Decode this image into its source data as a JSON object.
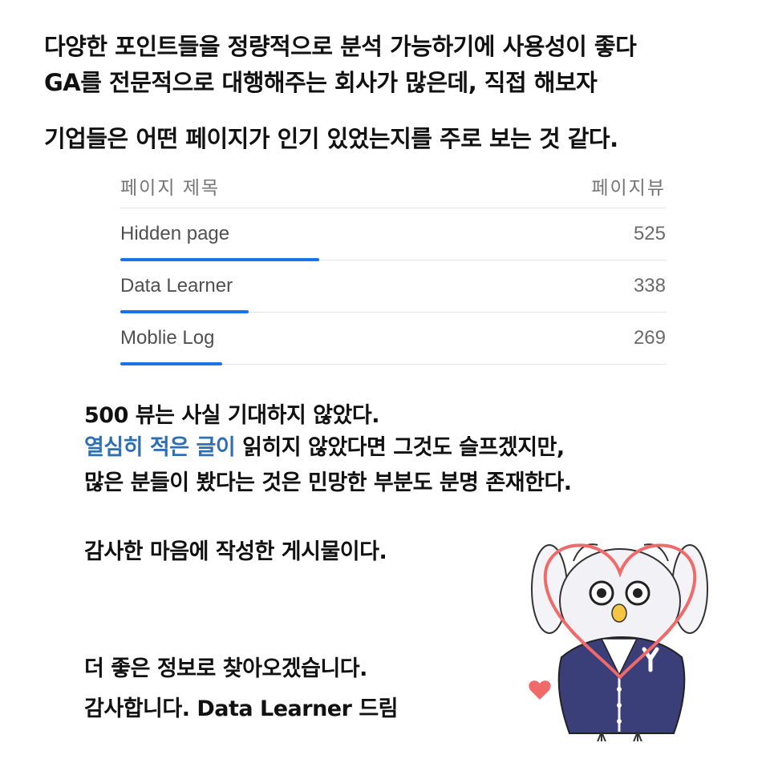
{
  "intro": {
    "line1": "다양한 포인트들을 정량적으로 분석 가능하기에 사용성이 좋다",
    "line2": "GA를 전문적으로 대행해주는 회사가 많은데, 직접 해보자",
    "line3": "기업들은 어떤 페이지가 인기 있었는지를 주로 보는 것 같다."
  },
  "table": {
    "header_title": "페이지 제목",
    "header_views": "페이지뷰",
    "rows": [
      {
        "name": "Hidden page",
        "views": "525",
        "fraction": 1.0
      },
      {
        "name": "Data Learner",
        "views": "338",
        "fraction": 0.644
      },
      {
        "name": "Moblie Log",
        "views": "269",
        "fraction": 0.512
      }
    ],
    "bar_color": "#1a73e8"
  },
  "message": {
    "p1": "500 뷰는 사실 기대하지 않았다.",
    "p2_highlight": "열심히 적은 글이",
    "p2_rest": " 읽히지 않았다면 그것도 슬프겠지만,",
    "p3": "많은 분들이 봤다는 것은 민망한 부분도 분명 존재한다.",
    "p4": "감사한 마음에 작성한 게시물이다.",
    "p5": "더 좋은 정보로 찾아오겠습니다.",
    "p6": "감사합니다. Data Learner 드림"
  },
  "colors": {
    "highlight": "#2f6fb4",
    "heart": "#f06a6a",
    "jacket": "#3a3f7a"
  }
}
